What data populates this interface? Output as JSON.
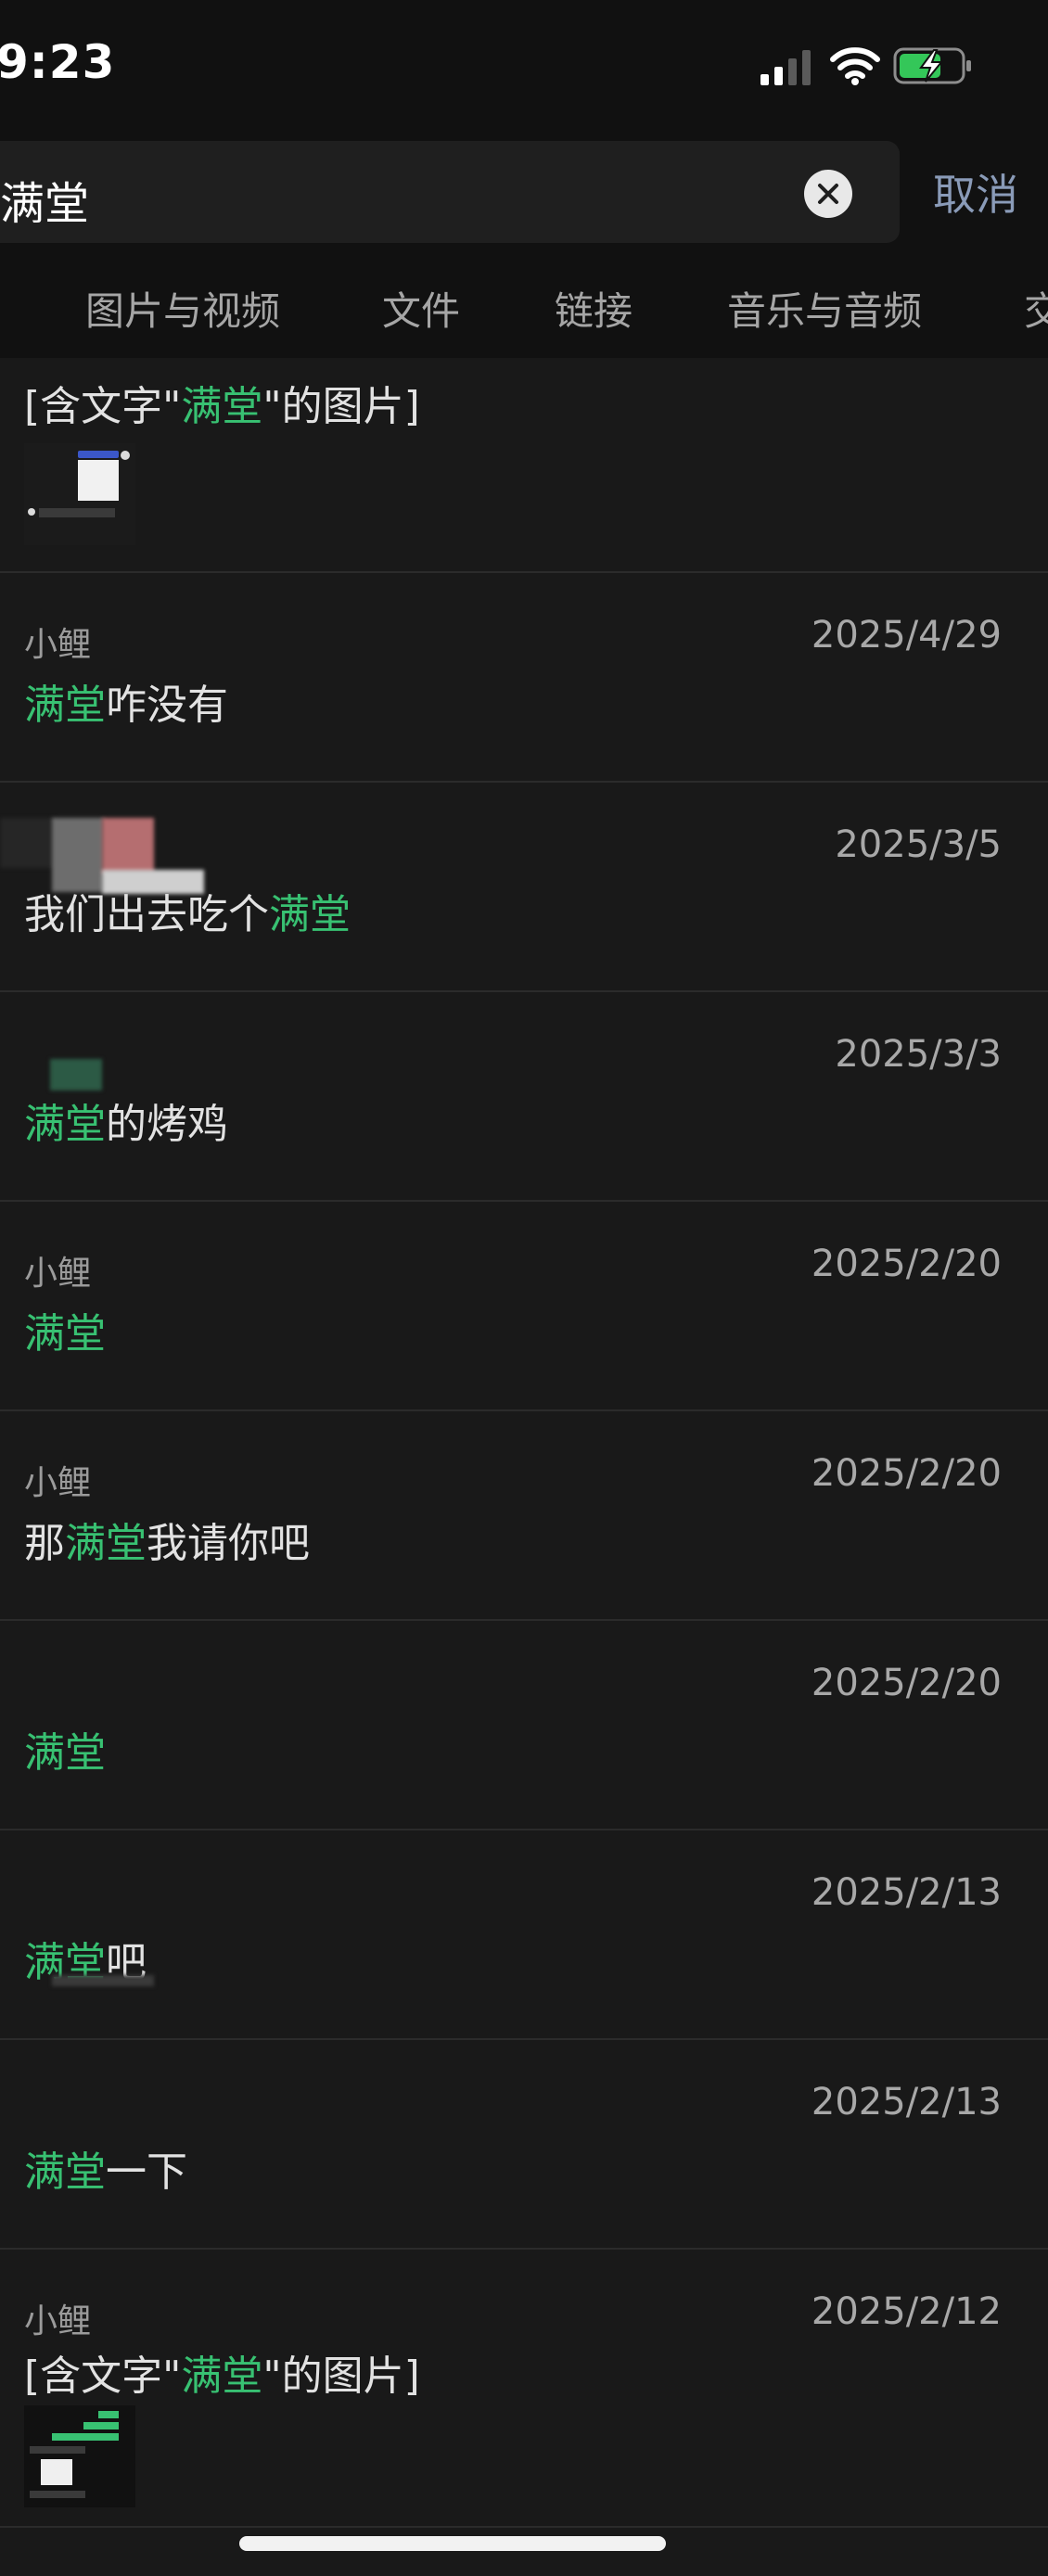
{
  "status": {
    "time": "9:23"
  },
  "search": {
    "query": "满堂",
    "cancel_label": "取消"
  },
  "tabs": [
    "图片与视频",
    "文件",
    "链接",
    "音乐与音频",
    "交"
  ],
  "results": [
    {
      "sender": "",
      "date": "",
      "parts": [
        "[含文字\"",
        "满堂",
        "\"的图片]"
      ],
      "has_image": true
    },
    {
      "sender": "小鲤",
      "date": "2025/4/29",
      "parts": [
        "",
        "满堂",
        "咋没有"
      ],
      "has_image": false
    },
    {
      "sender": "",
      "date": "2025/3/5",
      "parts": [
        "我们出去吃个",
        "满堂",
        ""
      ],
      "has_image": false
    },
    {
      "sender": "",
      "date": "2025/3/3",
      "parts": [
        "",
        "满堂",
        "的烤鸡"
      ],
      "has_image": false
    },
    {
      "sender": "小鲤",
      "date": "2025/2/20",
      "parts": [
        "",
        "满堂",
        ""
      ],
      "has_image": false
    },
    {
      "sender": "小鲤",
      "date": "2025/2/20",
      "parts": [
        "那",
        "满堂",
        "我请你吧"
      ],
      "has_image": false
    },
    {
      "sender": "",
      "date": "2025/2/20",
      "parts": [
        "",
        "满堂",
        ""
      ],
      "has_image": false
    },
    {
      "sender": "",
      "date": "2025/2/13",
      "parts": [
        "",
        "满堂",
        "吧"
      ],
      "has_image": false
    },
    {
      "sender": "",
      "date": "2025/2/13",
      "parts": [
        "",
        "满堂",
        "一下"
      ],
      "has_image": false
    },
    {
      "sender": "小鲤",
      "date": "2025/2/12",
      "parts": [
        "[含文字\"",
        "满堂",
        "\"的图片]"
      ],
      "has_image": true
    }
  ],
  "colors": {
    "highlight": "#38c172",
    "background": "#191919",
    "cancel": "#8a9bb8"
  }
}
